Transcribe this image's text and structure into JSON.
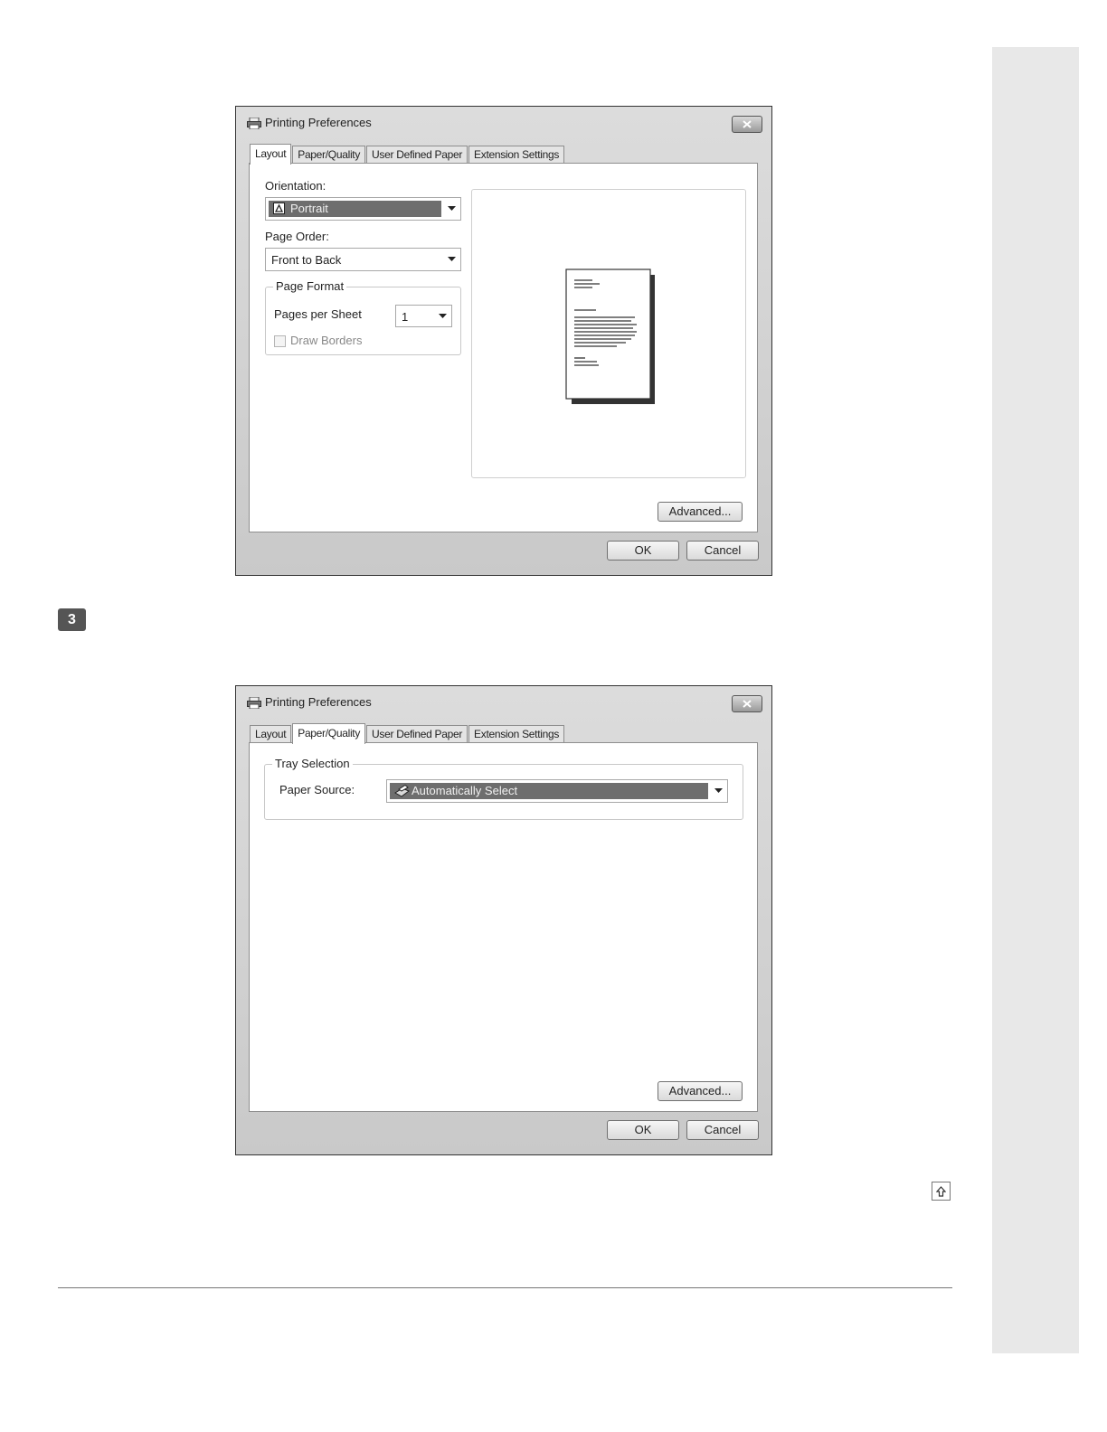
{
  "step_number": "3",
  "dialog1": {
    "title": "Printing Preferences",
    "tabs": [
      "Layout",
      "Paper/Quality",
      "User Defined Paper",
      "Extension Settings"
    ],
    "active_tab": "Layout",
    "orientation_label": "Orientation:",
    "orientation_value": "Portrait",
    "page_order_label": "Page Order:",
    "page_order_value": "Front to Back",
    "page_format_title": "Page Format",
    "pages_per_sheet_label": "Pages per Sheet",
    "pages_per_sheet_value": "1",
    "draw_borders_label": "Draw Borders",
    "draw_borders_checked": false,
    "advanced_label": "Advanced...",
    "ok_label": "OK",
    "cancel_label": "Cancel"
  },
  "dialog2": {
    "title": "Printing Preferences",
    "tabs": [
      "Layout",
      "Paper/Quality",
      "User Defined Paper",
      "Extension Settings"
    ],
    "active_tab": "Paper/Quality",
    "tray_selection_title": "Tray Selection",
    "paper_source_label": "Paper Source:",
    "paper_source_value": "Automatically Select",
    "advanced_label": "Advanced...",
    "ok_label": "OK",
    "cancel_label": "Cancel"
  },
  "icons": {
    "printer": "printer-icon",
    "close": "close-icon",
    "dropdown": "chevron-down-icon",
    "portrait": "portrait-orientation-icon",
    "tray": "paper-tray-icon",
    "top": "arrow-up-icon"
  }
}
